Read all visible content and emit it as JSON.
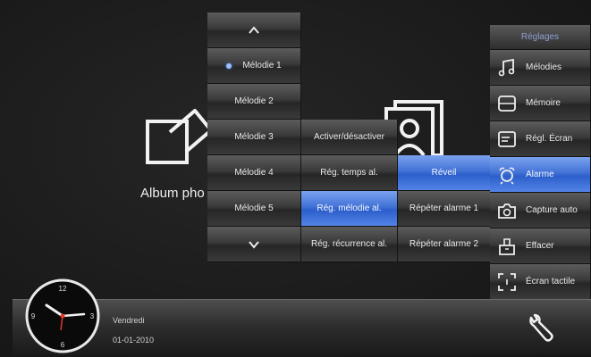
{
  "desktop": {
    "album_label": "Album pho"
  },
  "melody_menu": {
    "up_icon": "chevron-up-icon",
    "down_icon": "chevron-down-icon",
    "items": [
      {
        "label": "Mélodie 1",
        "selected": true
      },
      {
        "label": "Mélodie 2",
        "selected": false
      },
      {
        "label": "Mélodie 3",
        "selected": false
      },
      {
        "label": "Mélodie 4",
        "selected": false
      },
      {
        "label": "Mélodie 5",
        "selected": false
      }
    ]
  },
  "alarm_settings": {
    "items": [
      {
        "label": "Activer/désactiver"
      },
      {
        "label": "Rég. temps al."
      },
      {
        "label": "Rég. mélodie al."
      },
      {
        "label": "Rég. récurrence al."
      }
    ]
  },
  "alarm_list": {
    "items": [
      {
        "label": "Réveil"
      },
      {
        "label": "Répéter alarme 1"
      },
      {
        "label": "Répéter alarme 2"
      }
    ]
  },
  "settings_menu": {
    "title": "Réglages",
    "items": [
      {
        "label": "Mélodies",
        "icon": "music-note-icon"
      },
      {
        "label": "Mémoire",
        "icon": "memory-icon"
      },
      {
        "label": "Régl. Écran",
        "icon": "screen-icon"
      },
      {
        "label": "Alarme",
        "icon": "alarm-bell-icon"
      },
      {
        "label": "Capture auto",
        "icon": "camera-icon"
      },
      {
        "label": "Effacer",
        "icon": "erase-icon"
      },
      {
        "label": "Écran tactile",
        "icon": "touchscreen-icon"
      }
    ]
  },
  "statusbar": {
    "day": "Vendredi",
    "date": "01-01-2010",
    "settings_icon": "wrench-icon"
  },
  "clock": {
    "numerals": [
      "12",
      "3",
      "6",
      "9"
    ]
  },
  "colors": {
    "selection": "#3c6cd4",
    "background": "#1c1c1c"
  }
}
